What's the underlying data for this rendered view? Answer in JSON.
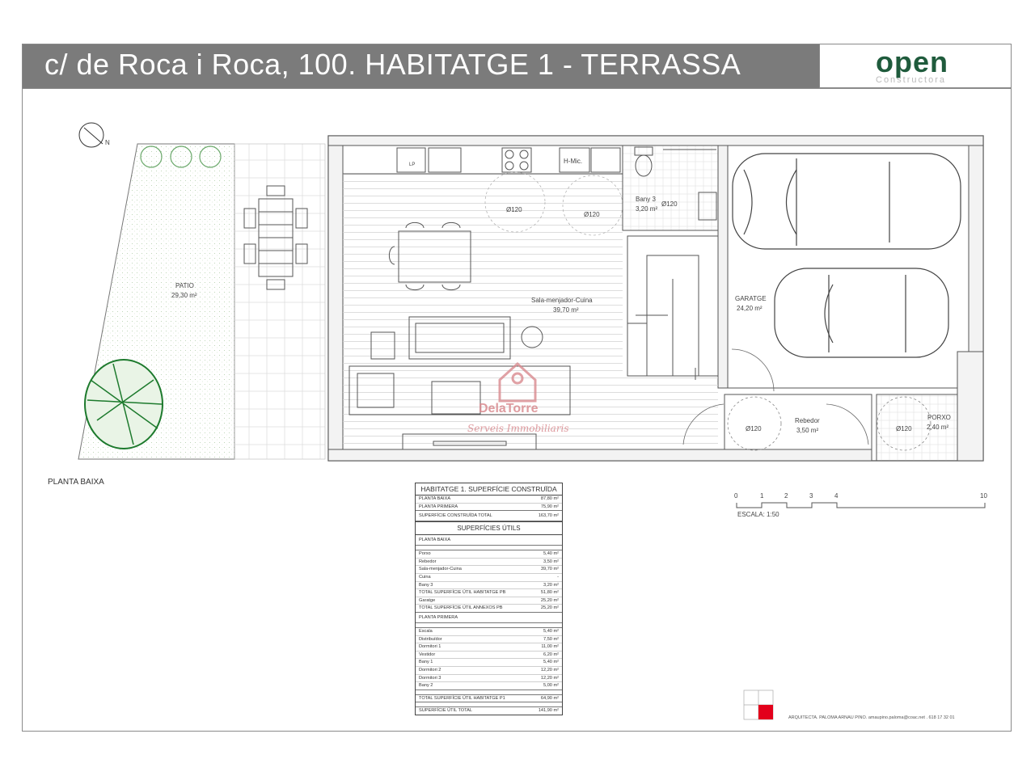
{
  "header": {
    "title": "c/ de Roca i Roca, 100. HABITATGE 1 - TERRASSA",
    "logo_word": "open",
    "logo_sub": "Constructora"
  },
  "rooms": {
    "patio_name": "PATIO",
    "patio_area": "29,30 m²",
    "sala_name": "Sala-menjador-Cuina",
    "sala_area": "39,70 m²",
    "hmic": "H-Mic.",
    "lp": "LP",
    "bany_name": "Bany 3",
    "bany_area": "3,20 m²",
    "garatge_name": "GARATGE",
    "garatge_area": "24,20 m²",
    "rebedor_name": "Rebedor",
    "rebedor_area": "3,50 m²",
    "porxo_name": "PORXO",
    "porxo_area": "2,40 m²",
    "accessibility_diameter": "Ø120"
  },
  "compass": {
    "north": "N"
  },
  "plan_label": "PLANTA BAIXA",
  "watermark": {
    "name": "DelaTorre",
    "tagline": "Serveis Immobiliaris"
  },
  "surface_table": {
    "title": "HABITATGE 1. SUPERFÍCIE CONSTRUÏDA",
    "built_rows": [
      {
        "label": "PLANTA BAIXA",
        "value": "87,80 m²"
      },
      {
        "label": "PLANTA PRIMERA",
        "value": "75,90 m²"
      }
    ],
    "built_total": {
      "label": "SUPERFÍCIE CONSTRUÏDA TOTAL",
      "value": "163,70 m²"
    },
    "useful_title": "SUPERFÍCIES ÚTILS",
    "pb_title": "PLANTA BAIXA",
    "pb_rows": [
      {
        "label": "Porxo",
        "value": "5,40 m²"
      },
      {
        "label": "Rebedor",
        "value": "3,50 m²"
      },
      {
        "label": "Sala-menjador-Cuina",
        "value": "39,70 m²"
      },
      {
        "label": "Cuina",
        "value": "-"
      },
      {
        "label": "Bany 3",
        "value": "3,20 m²"
      },
      {
        "label": "TOTAL SUPERFÍCIE ÚTIL HABITATGE PB",
        "value": "51,80 m²"
      },
      {
        "label": "Garatge",
        "value": "25,20 m²"
      },
      {
        "label": "TOTAL SUPERFÍCIE ÚTIL ANNEXOS PB",
        "value": "25,20 m²"
      }
    ],
    "p1_title": "PLANTA PRIMERA",
    "p1_rows": [
      {
        "label": "Escala",
        "value": "5,40 m²"
      },
      {
        "label": "Distribuïdor",
        "value": "7,50 m²"
      },
      {
        "label": "Dormitori 1",
        "value": "11,00 m²"
      },
      {
        "label": "Vestidor",
        "value": "6,20 m²"
      },
      {
        "label": "Bany 1",
        "value": "5,40 m²"
      },
      {
        "label": "Dormitori 2",
        "value": "12,20 m²"
      },
      {
        "label": "Dormitori 3",
        "value": "12,20 m²"
      },
      {
        "label": "Bany 2",
        "value": "5,00 m²"
      }
    ],
    "p1_total": {
      "label": "TOTAL SUPERFÍCIE ÚTIL HABITATGE P1",
      "value": "64,90 m²"
    },
    "grand_total": {
      "label": "SUPERFÍCIE ÚTIL TOTAL",
      "value": "141,90 m²"
    }
  },
  "scale": {
    "ticks": [
      "0",
      "1",
      "2",
      "3",
      "4",
      "10"
    ],
    "label": "ESCALA: 1:50"
  },
  "credit": "ARQUITECTA. PALOMA ARNAU PINO. amaupino.paloma@coac.net . 618 17 32 01",
  "colors": {
    "title_bar": "#7b7b7b",
    "logo": "#1f5b3c",
    "accent": "#e3001b",
    "watermark": "#d98a8f"
  }
}
